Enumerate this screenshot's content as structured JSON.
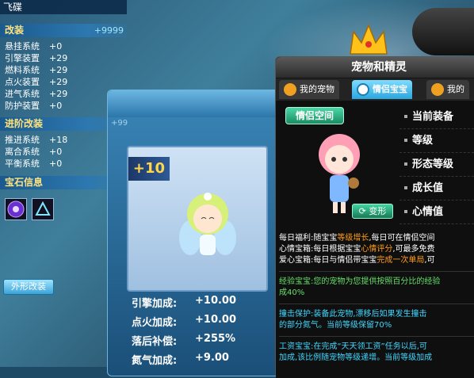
{
  "left_panel": {
    "player_name": "飞碟",
    "modify": {
      "title": "改装",
      "score": "+9999",
      "items": [
        {
          "label": "悬挂系统",
          "value": "+0"
        },
        {
          "label": "引擎装置",
          "value": "+29"
        },
        {
          "label": "燃料系统",
          "value": "+29"
        },
        {
          "label": "点火装置",
          "value": "+29"
        },
        {
          "label": "进气系统",
          "value": "+29"
        },
        {
          "label": "防护装置",
          "value": "+0"
        }
      ]
    },
    "advanced": {
      "title": "进阶改装",
      "items": [
        {
          "label": "推进系统",
          "value": "+18"
        },
        {
          "label": "离合系统",
          "value": "+0"
        },
        {
          "label": "平衡系统",
          "value": "+0"
        }
      ]
    },
    "gems": {
      "title": "宝石信息"
    },
    "appearance_button": "外形改装"
  },
  "middle_card": {
    "hidden_value": "+99",
    "level": "+10",
    "attributes": [
      {
        "label": "引擎加成:",
        "value": "+10.00"
      },
      {
        "label": "点火加成:",
        "value": "+10.00"
      },
      {
        "label": "落后补偿:",
        "value": "+255%"
      },
      {
        "label": "氮气加成:",
        "value": "+9.00"
      }
    ]
  },
  "pet_window": {
    "title": "宠物和精灵",
    "tabs": [
      {
        "label": "我的宠物"
      },
      {
        "label": "情侣宝宝"
      },
      {
        "label": "我的"
      }
    ],
    "couple_space_button": "情侣空间",
    "transform_button": "变形",
    "info_items": [
      "当前装备",
      "等级",
      "形态等级",
      "成长值",
      "心情值"
    ],
    "daily": {
      "line1": {
        "a": "每日福利:随宝宝",
        "b": "等级增长",
        "c": ",每日可在情侣空间"
      },
      "line2": {
        "a": "心情宝箱:每日根据宝宝",
        "b": "心情评分",
        "c": ",可最多免费"
      },
      "line3": {
        "a": "爱心宝箱:每日与情侣带宝宝",
        "b": "完成一次单局",
        "c": ",可"
      }
    },
    "exp": {
      "line1": "经验宝宝:您的宠物为您提供按照百分比的经验",
      "line2": "成40%"
    },
    "collision": {
      "line1": "撞击保护:装备此宠物,漂移后如果发生撞击",
      "line2": "的部分氮气。当前等级保留70%"
    },
    "salary": {
      "line1": "工资宝宝:在完成“天天领工资”任务以后,可",
      "line2": "加成,该比例随宠物等级递增。当前等级加成"
    }
  },
  "colors": {
    "accent": "#2aa6de",
    "gold": "#ffd64a",
    "orange": "#ff9c1a",
    "green": "#66e06a",
    "cyan": "#3fd7ff"
  }
}
